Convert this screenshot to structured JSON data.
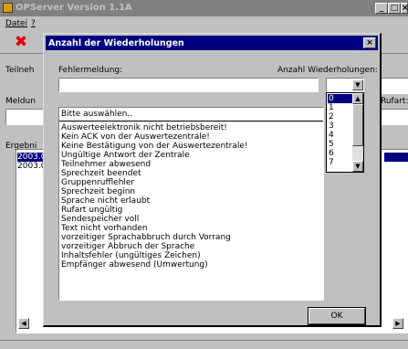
{
  "main_window": {
    "title": "OPServer Version 1.1A",
    "menu": [
      "Datei",
      "?"
    ],
    "labels": {
      "teilnehmer": "Teilneh",
      "meldung": "Meldun",
      "ergebnis": "Ergebni",
      "rufart": "Rufart:"
    },
    "result_rows": [
      "2003.0",
      "2003.0"
    ]
  },
  "dialog": {
    "title": "Anzahl der Wiederholungen",
    "close_glyph": "×",
    "fehlermeldung_label": "Fehlermeldung:",
    "fehlermeldung_value": "",
    "anzahl_label": "Anzahl Wiederholungen:",
    "anzahl_value": "",
    "list_header": "Bitte auswählen..",
    "items": [
      "Auswerteelektronik nicht betriebsbereit!",
      "Kein ACK von der Auswertezentrale!",
      "Keine Bestätigung von der Auswertezentrale!",
      "Ungültige Antwort der Zentrale",
      "Teilnehmer abwesend",
      "Sprechzeit beendet",
      "Gruppenrufflehler",
      "Sprechzeit beginn",
      "Sprache nicht erlaubt",
      "Rufart ungültig",
      "Sendespeicher voll",
      "Text nicht vorhanden",
      "vorzeitiger Sprachabbruch durch Vorrang",
      "vorzeitiger Abbruch der Sprache",
      "Inhaltsfehler (ungültiges Zeichen)",
      "Empfänger abwesend (Umwertung)"
    ],
    "count_options": [
      "0",
      "1",
      "2",
      "3",
      "4",
      "5",
      "6",
      "7"
    ],
    "selected_count": "0",
    "ok_label": "OK"
  },
  "colors": {
    "face": "#c0c0c0",
    "active_title": "#000080",
    "inactive_title": "#808080",
    "selection": "#000080"
  },
  "icons": [
    "app-icon",
    "minimize-icon",
    "maximize-icon",
    "close-icon",
    "delete-x-icon",
    "dropdown-arrow-icon",
    "scroll-up-icon",
    "scroll-down-icon",
    "scroll-left-icon",
    "scroll-right-icon"
  ]
}
